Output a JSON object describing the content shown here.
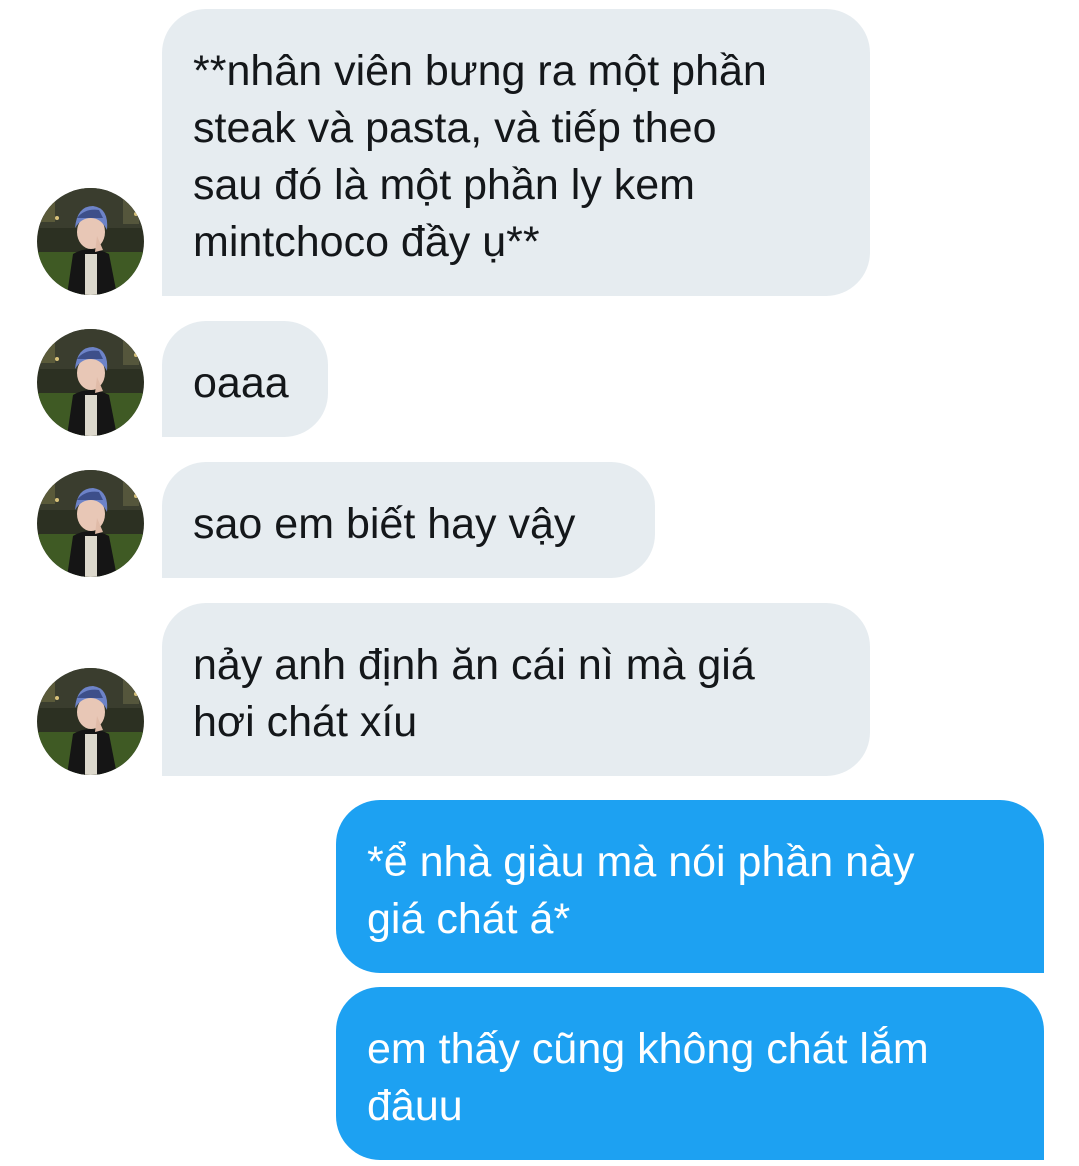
{
  "conversation": {
    "messages": [
      {
        "direction": "incoming",
        "text": "**nhân viên bưng ra một phần\nsteak và pasta, và tiếp theo\nsau đó là một phần ly kem\nmintchoco đầy ụ**"
      },
      {
        "direction": "incoming",
        "text": "oaaa"
      },
      {
        "direction": "incoming",
        "text": "sao em biết hay vậy"
      },
      {
        "direction": "incoming",
        "text": "nảy anh định ăn cái nì mà giá\nhơi chát xíu"
      },
      {
        "direction": "outgoing",
        "text": "*ể nhà giàu mà nói phần này\ngiá chát á*"
      },
      {
        "direction": "outgoing",
        "text": "em thấy cũng không chát lắm\nđâuu"
      }
    ]
  },
  "theme": {
    "incoming_bubble_color": "#e6ecf0",
    "incoming_text_color": "#14171a",
    "outgoing_bubble_color": "#1da1f2",
    "outgoing_text_color": "#ffffff",
    "background_color": "#ffffff"
  },
  "icons": {
    "avatar": "user-avatar-photo"
  }
}
